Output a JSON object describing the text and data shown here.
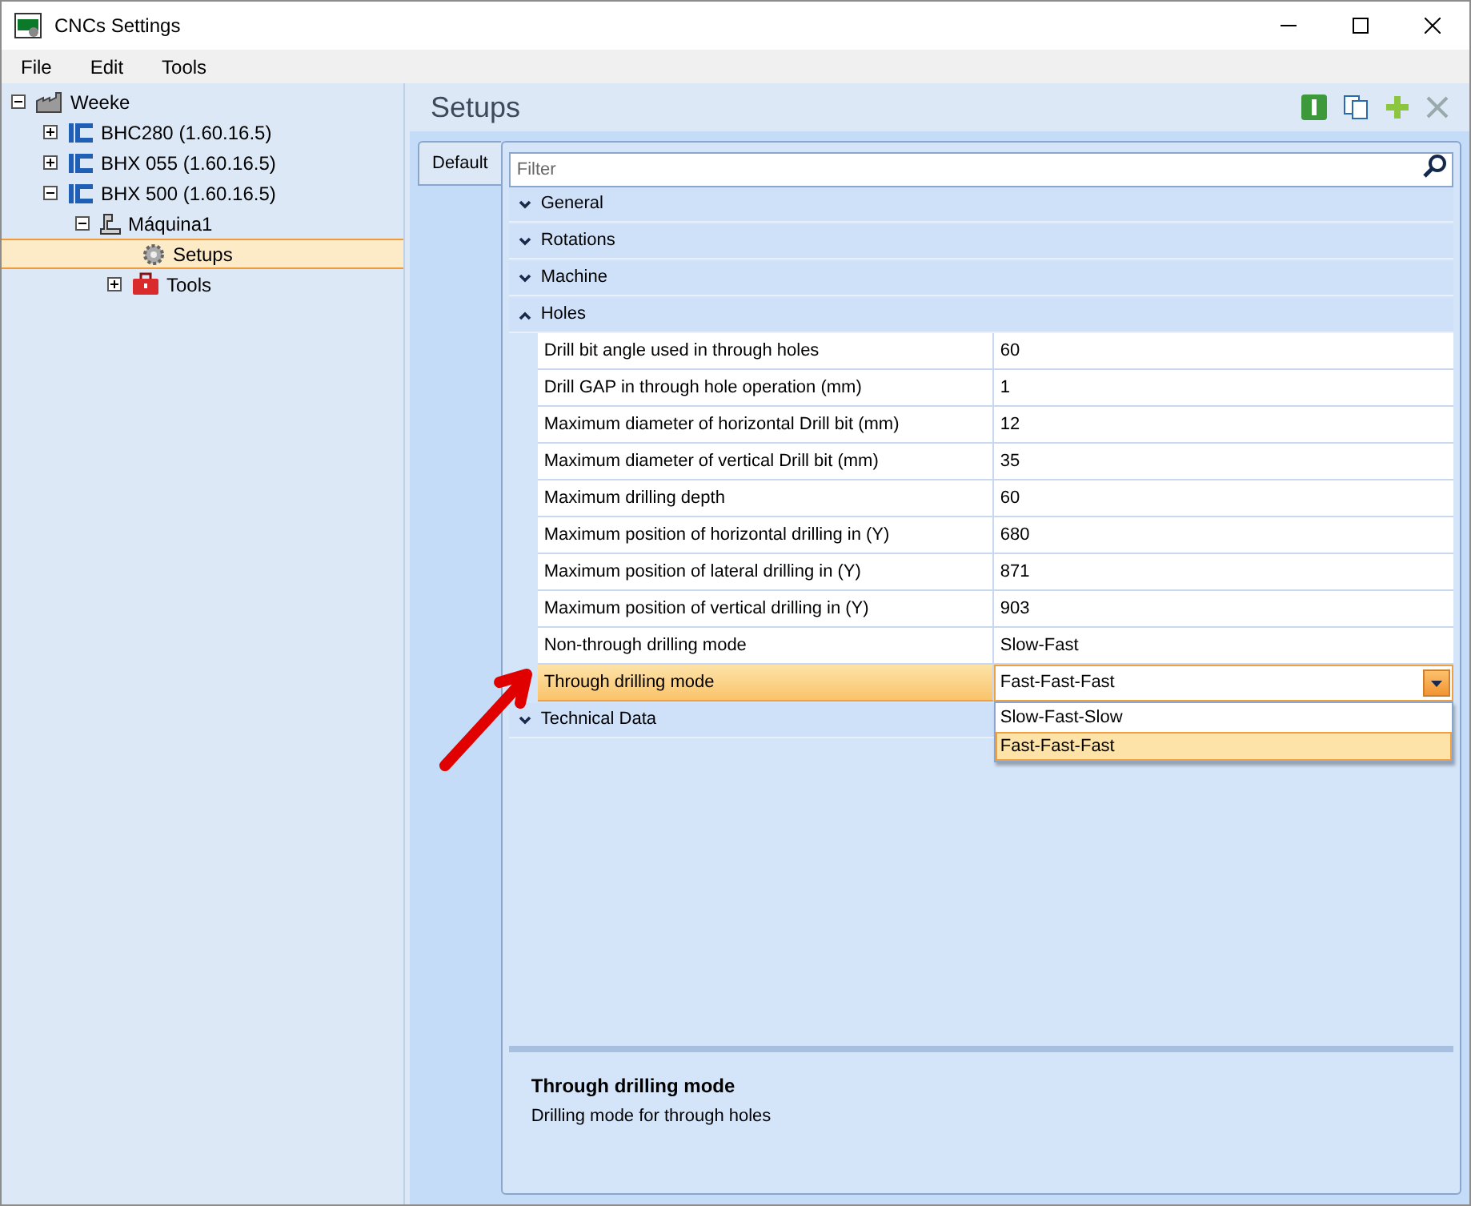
{
  "window": {
    "title": "CNCs Settings"
  },
  "menu": [
    "File",
    "Edit",
    "Tools"
  ],
  "tree": [
    {
      "label": "Weeke",
      "kind": "factory",
      "expanded": true,
      "selected": false,
      "children": [
        {
          "label": "BHC280 (1.60.16.5)",
          "kind": "machine",
          "expanded": false,
          "selected": false
        },
        {
          "label": "BHX 055 (1.60.16.5)",
          "kind": "machine",
          "expanded": false,
          "selected": false
        },
        {
          "label": "BHX 500 (1.60.16.5)",
          "kind": "machine",
          "expanded": true,
          "selected": false,
          "children": [
            {
              "label": "Máquina1",
              "kind": "station",
              "expanded": true,
              "selected": false,
              "children": [
                {
                  "label": "Setups",
                  "kind": "gear",
                  "selected": true
                },
                {
                  "label": "Tools",
                  "kind": "toolbox",
                  "expanded": false,
                  "selected": false
                }
              ]
            }
          ]
        }
      ]
    }
  ],
  "panel": {
    "title": "Setups"
  },
  "tabs": [
    {
      "label": "Default",
      "selected": true
    }
  ],
  "filter": {
    "placeholder": "Filter"
  },
  "categories": [
    {
      "name": "General",
      "expanded": false
    },
    {
      "name": "Rotations",
      "expanded": false
    },
    {
      "name": "Machine",
      "expanded": false
    },
    {
      "name": "Holes",
      "expanded": true,
      "properties": [
        {
          "name": "Drill bit angle used in through holes",
          "value": "60",
          "selected": false,
          "kind": "text"
        },
        {
          "name": "Drill GAP in through hole operation (mm)",
          "value": "1",
          "selected": false,
          "kind": "text"
        },
        {
          "name": "Maximum diameter of horizontal Drill bit (mm)",
          "value": "12",
          "selected": false,
          "kind": "text"
        },
        {
          "name": "Maximum diameter of vertical Drill bit (mm)",
          "value": "35",
          "selected": false,
          "kind": "text"
        },
        {
          "name": "Maximum drilling depth",
          "value": "60",
          "selected": false,
          "kind": "text"
        },
        {
          "name": "Maximum position of horizontal drilling in (Y)",
          "value": "680",
          "selected": false,
          "kind": "text"
        },
        {
          "name": "Maximum position of lateral drilling in (Y)",
          "value": "871",
          "selected": false,
          "kind": "text"
        },
        {
          "name": "Maximum position of vertical drilling in (Y)",
          "value": "903",
          "selected": false,
          "kind": "text"
        },
        {
          "name": "Non-through drilling mode",
          "value": "Slow-Fast",
          "selected": false,
          "kind": "text"
        },
        {
          "name": "Through drilling mode",
          "value": "Fast-Fast-Fast",
          "selected": true,
          "kind": "dropdown",
          "options": [
            {
              "label": "Slow-Fast-Slow",
              "selected": false
            },
            {
              "label": "Fast-Fast-Fast",
              "selected": true
            }
          ]
        }
      ]
    },
    {
      "name": "Technical Data",
      "expanded": false
    }
  ],
  "description": {
    "title": "Through drilling mode",
    "text": "Drilling mode for through holes"
  }
}
